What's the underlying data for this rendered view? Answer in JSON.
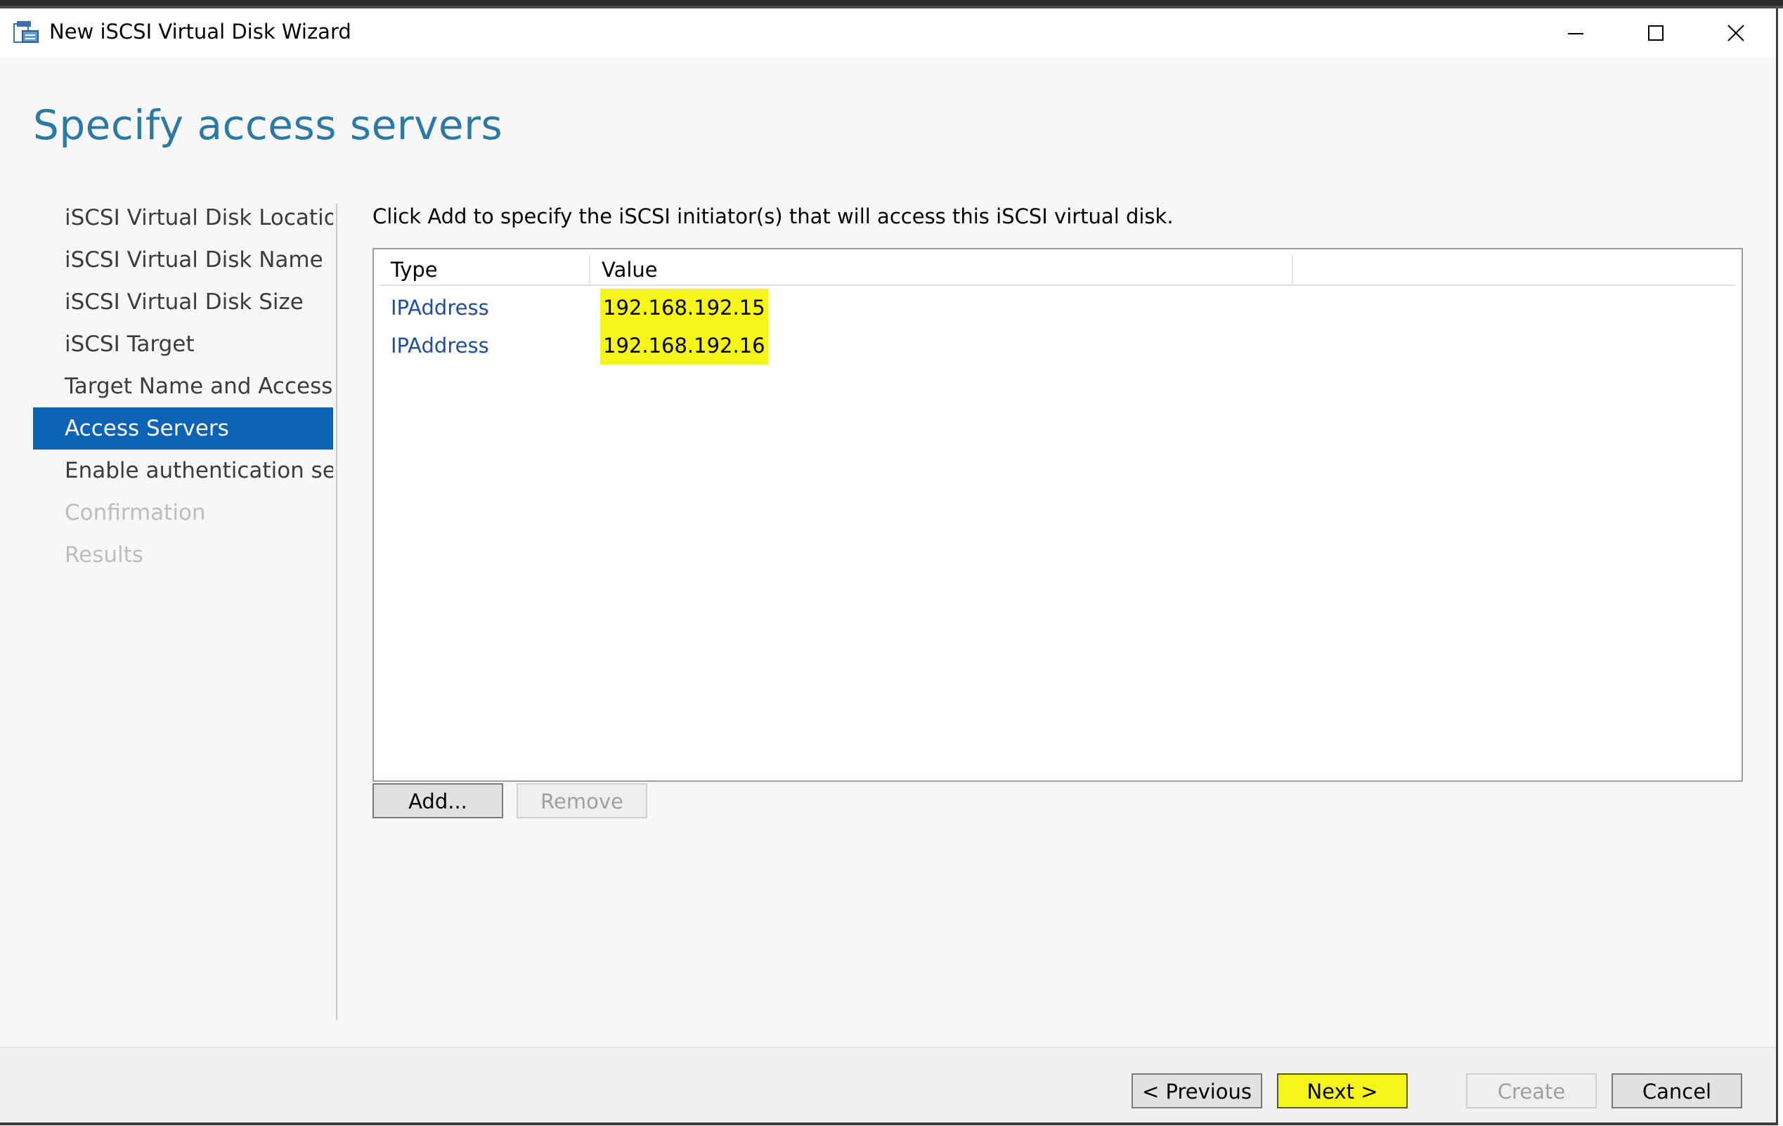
{
  "window": {
    "title": "New iSCSI Virtual Disk Wizard",
    "icon": "iscsi-wizard-icon"
  },
  "page": {
    "title": "Specify access servers",
    "instruction": "Click Add to specify the iSCSI initiator(s) that will access this iSCSI virtual disk."
  },
  "nav": {
    "items": [
      {
        "label": "iSCSI Virtual Disk Location",
        "state": "normal"
      },
      {
        "label": "iSCSI Virtual Disk Name",
        "state": "normal"
      },
      {
        "label": "iSCSI Virtual Disk Size",
        "state": "normal"
      },
      {
        "label": "iSCSI Target",
        "state": "normal"
      },
      {
        "label": "Target Name and Access",
        "state": "normal"
      },
      {
        "label": "Access Servers",
        "state": "active"
      },
      {
        "label": "Enable authentication ser...",
        "state": "normal"
      },
      {
        "label": "Confirmation",
        "state": "disabled"
      },
      {
        "label": "Results",
        "state": "disabled"
      }
    ]
  },
  "table": {
    "columns": [
      "Type",
      "Value",
      ""
    ],
    "rows": [
      {
        "type": "IPAddress",
        "value": "192.168.192.15"
      },
      {
        "type": "IPAddress",
        "value": "192.168.192.16"
      }
    ]
  },
  "list_buttons": {
    "add": "Add...",
    "remove": "Remove"
  },
  "footer_buttons": {
    "previous": "< Previous",
    "next": "Next >",
    "create": "Create",
    "cancel": "Cancel"
  },
  "colors": {
    "accent": "#0a63b5",
    "title": "#2b7aa3",
    "highlight": "#f5f51a"
  }
}
